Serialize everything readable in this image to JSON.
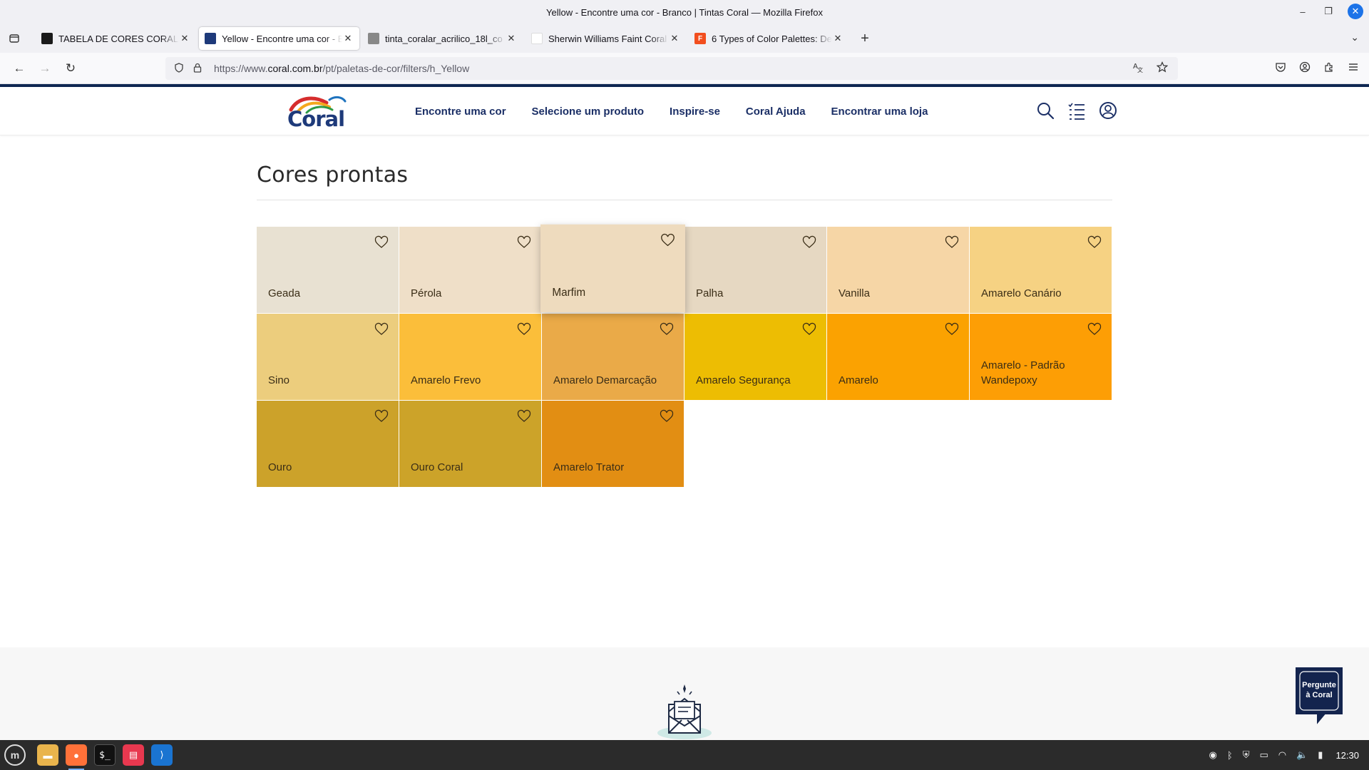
{
  "window": {
    "title": "Yellow - Encontre uma cor - Branco | Tintas Coral — Mozilla Firefox",
    "controls": {
      "minimize": "–",
      "maximize": "❐",
      "close": "✕"
    }
  },
  "tabs": [
    {
      "label": "TABELA DE CORES CORAL - ",
      "favicon_color": "#1a1a1a",
      "favicon_text": "",
      "active": false
    },
    {
      "label": "Yellow - Encontre uma cor - B",
      "favicon_color": "#1e3a7a",
      "favicon_text": "",
      "active": true
    },
    {
      "label": "tinta_coralar_acrilico_18l_co",
      "favicon_color": "#888888",
      "favicon_text": "",
      "active": false
    },
    {
      "label": "Sherwin Williams Faint Coral",
      "favicon_color": "#ffffff",
      "favicon_text": "",
      "active": false
    },
    {
      "label": "6 Types of Color Palettes: De",
      "favicon_color": "#f24e1e",
      "favicon_text": "F",
      "active": false
    }
  ],
  "tab_close_glyph": "✕",
  "new_tab_glyph": "+",
  "tab_overflow_glyph": "⌄",
  "urlbar": {
    "url_prefix": "https://www.",
    "url_domain": "coral.com.br",
    "url_path": "/pt/paletas-de-cor/filters/h_Yellow"
  },
  "site": {
    "logo_text": "Coral",
    "brand_blue": "#1b2f66",
    "nav": [
      "Encontre uma cor",
      "Selecione um produto",
      "Inspire-se",
      "Coral Ajuda",
      "Encontrar uma loja"
    ],
    "section_title": "Cores prontas",
    "swatches": [
      {
        "name": "Geada",
        "color": "#e8e1d2"
      },
      {
        "name": "Pérola",
        "color": "#efdfc8"
      },
      {
        "name": "Marfim",
        "color": "#eedbbe"
      },
      {
        "name": "Palha",
        "color": "#e6d8c2"
      },
      {
        "name": "Vanilla",
        "color": "#f6d6a6"
      },
      {
        "name": "Amarelo Canário",
        "color": "#f6d283"
      },
      {
        "name": "Sino",
        "color": "#eccd7d"
      },
      {
        "name": "Amarelo Frevo",
        "color": "#fbbe3a"
      },
      {
        "name": "Amarelo Demarcação",
        "color": "#eaaa48"
      },
      {
        "name": "Amarelo Segurança",
        "color": "#edbd03"
      },
      {
        "name": "Amarelo",
        "color": "#fba201"
      },
      {
        "name": "Amarelo - Padrão Wandepoxy",
        "color": "#fd9e05"
      },
      {
        "name": "Ouro",
        "color": "#cca22a"
      },
      {
        "name": "Ouro Coral",
        "color": "#cca329"
      },
      {
        "name": "Amarelo Trator",
        "color": "#e28e13"
      }
    ],
    "highlighted_swatch_index": 2,
    "help_widget": {
      "line1": "Pergunte",
      "line2": "à Coral"
    }
  },
  "taskbar": {
    "clock": "12:30"
  }
}
